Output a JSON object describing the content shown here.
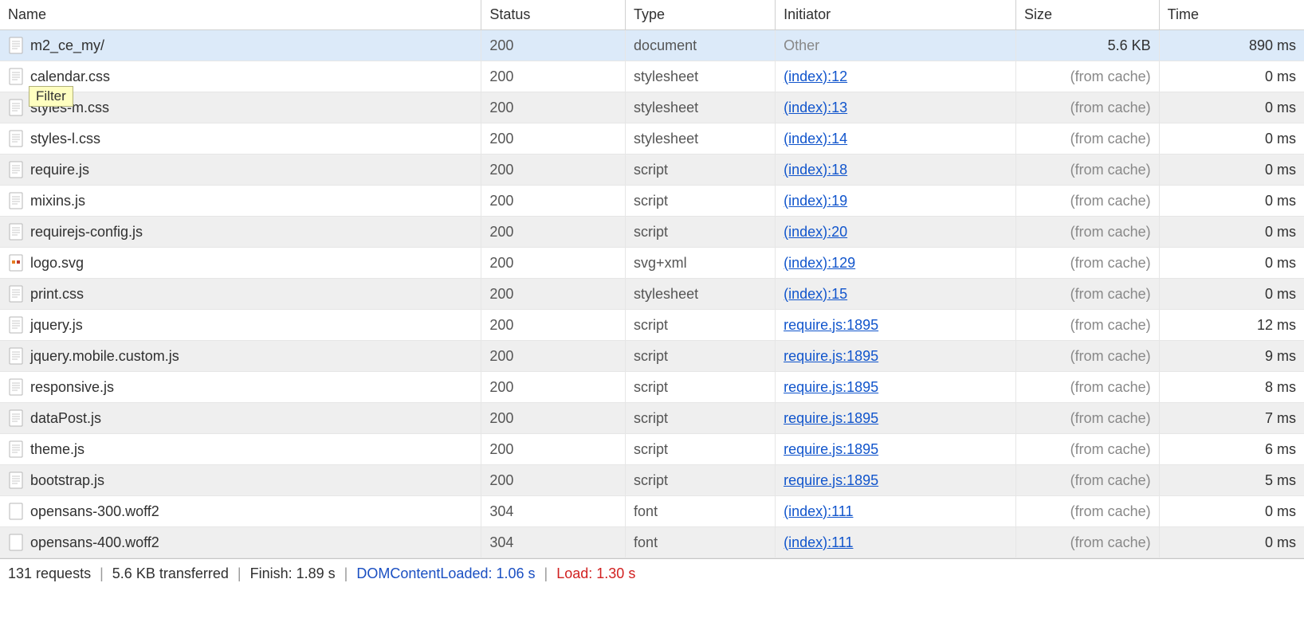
{
  "tooltip": "Filter",
  "columns": {
    "name": "Name",
    "status": "Status",
    "type": "Type",
    "initiator": "Initiator",
    "size": "Size",
    "time": "Time"
  },
  "icons": {
    "doc": "doc-icon",
    "svg": "svg-icon",
    "blank": "blank-icon"
  },
  "rows": [
    {
      "selected": true,
      "icon": "doc",
      "name": "m2_ce_my/",
      "status": "200",
      "type": "document",
      "initiator": {
        "text": "Other",
        "link": false
      },
      "size": "5.6 KB",
      "size_cache": false,
      "time": "890 ms"
    },
    {
      "icon": "doc",
      "name": "calendar.css",
      "status": "200",
      "type": "stylesheet",
      "initiator": {
        "text": "(index):12",
        "link": true
      },
      "size": "(from cache)",
      "size_cache": true,
      "time": "0 ms"
    },
    {
      "icon": "doc",
      "name": "styles-m.css",
      "status": "200",
      "type": "stylesheet",
      "initiator": {
        "text": "(index):13",
        "link": true
      },
      "size": "(from cache)",
      "size_cache": true,
      "time": "0 ms"
    },
    {
      "icon": "doc",
      "name": "styles-l.css",
      "status": "200",
      "type": "stylesheet",
      "initiator": {
        "text": "(index):14",
        "link": true
      },
      "size": "(from cache)",
      "size_cache": true,
      "time": "0 ms"
    },
    {
      "icon": "doc",
      "name": "require.js",
      "status": "200",
      "type": "script",
      "initiator": {
        "text": "(index):18",
        "link": true
      },
      "size": "(from cache)",
      "size_cache": true,
      "time": "0 ms"
    },
    {
      "icon": "doc",
      "name": "mixins.js",
      "status": "200",
      "type": "script",
      "initiator": {
        "text": "(index):19",
        "link": true
      },
      "size": "(from cache)",
      "size_cache": true,
      "time": "0 ms"
    },
    {
      "icon": "doc",
      "name": "requirejs-config.js",
      "status": "200",
      "type": "script",
      "initiator": {
        "text": "(index):20",
        "link": true
      },
      "size": "(from cache)",
      "size_cache": true,
      "time": "0 ms"
    },
    {
      "icon": "svg",
      "name": "logo.svg",
      "status": "200",
      "type": "svg+xml",
      "initiator": {
        "text": "(index):129",
        "link": true
      },
      "size": "(from cache)",
      "size_cache": true,
      "time": "0 ms"
    },
    {
      "icon": "doc",
      "name": "print.css",
      "status": "200",
      "type": "stylesheet",
      "initiator": {
        "text": "(index):15",
        "link": true
      },
      "size": "(from cache)",
      "size_cache": true,
      "time": "0 ms"
    },
    {
      "icon": "doc",
      "name": "jquery.js",
      "status": "200",
      "type": "script",
      "initiator": {
        "text": "require.js:1895",
        "link": true
      },
      "size": "(from cache)",
      "size_cache": true,
      "time": "12 ms"
    },
    {
      "icon": "doc",
      "name": "jquery.mobile.custom.js",
      "status": "200",
      "type": "script",
      "initiator": {
        "text": "require.js:1895",
        "link": true
      },
      "size": "(from cache)",
      "size_cache": true,
      "time": "9 ms"
    },
    {
      "icon": "doc",
      "name": "responsive.js",
      "status": "200",
      "type": "script",
      "initiator": {
        "text": "require.js:1895",
        "link": true
      },
      "size": "(from cache)",
      "size_cache": true,
      "time": "8 ms"
    },
    {
      "icon": "doc",
      "name": "dataPost.js",
      "status": "200",
      "type": "script",
      "initiator": {
        "text": "require.js:1895",
        "link": true
      },
      "size": "(from cache)",
      "size_cache": true,
      "time": "7 ms"
    },
    {
      "icon": "doc",
      "name": "theme.js",
      "status": "200",
      "type": "script",
      "initiator": {
        "text": "require.js:1895",
        "link": true
      },
      "size": "(from cache)",
      "size_cache": true,
      "time": "6 ms"
    },
    {
      "icon": "doc",
      "name": "bootstrap.js",
      "status": "200",
      "type": "script",
      "initiator": {
        "text": "require.js:1895",
        "link": true
      },
      "size": "(from cache)",
      "size_cache": true,
      "time": "5 ms"
    },
    {
      "icon": "blank",
      "name": "opensans-300.woff2",
      "status": "304",
      "type": "font",
      "initiator": {
        "text": "(index):111",
        "link": true
      },
      "size": "(from cache)",
      "size_cache": true,
      "time": "0 ms"
    },
    {
      "icon": "blank",
      "name": "opensans-400.woff2",
      "status": "304",
      "type": "font",
      "initiator": {
        "text": "(index):111",
        "link": true
      },
      "size": "(from cache)",
      "size_cache": true,
      "time": "0 ms"
    }
  ],
  "summary": {
    "requests": "131 requests",
    "transferred": "5.6 KB transferred",
    "finish": "Finish: 1.89 s",
    "dom": "DOMContentLoaded: 1.06 s",
    "load": "Load: 1.30 s",
    "sep": "|"
  }
}
